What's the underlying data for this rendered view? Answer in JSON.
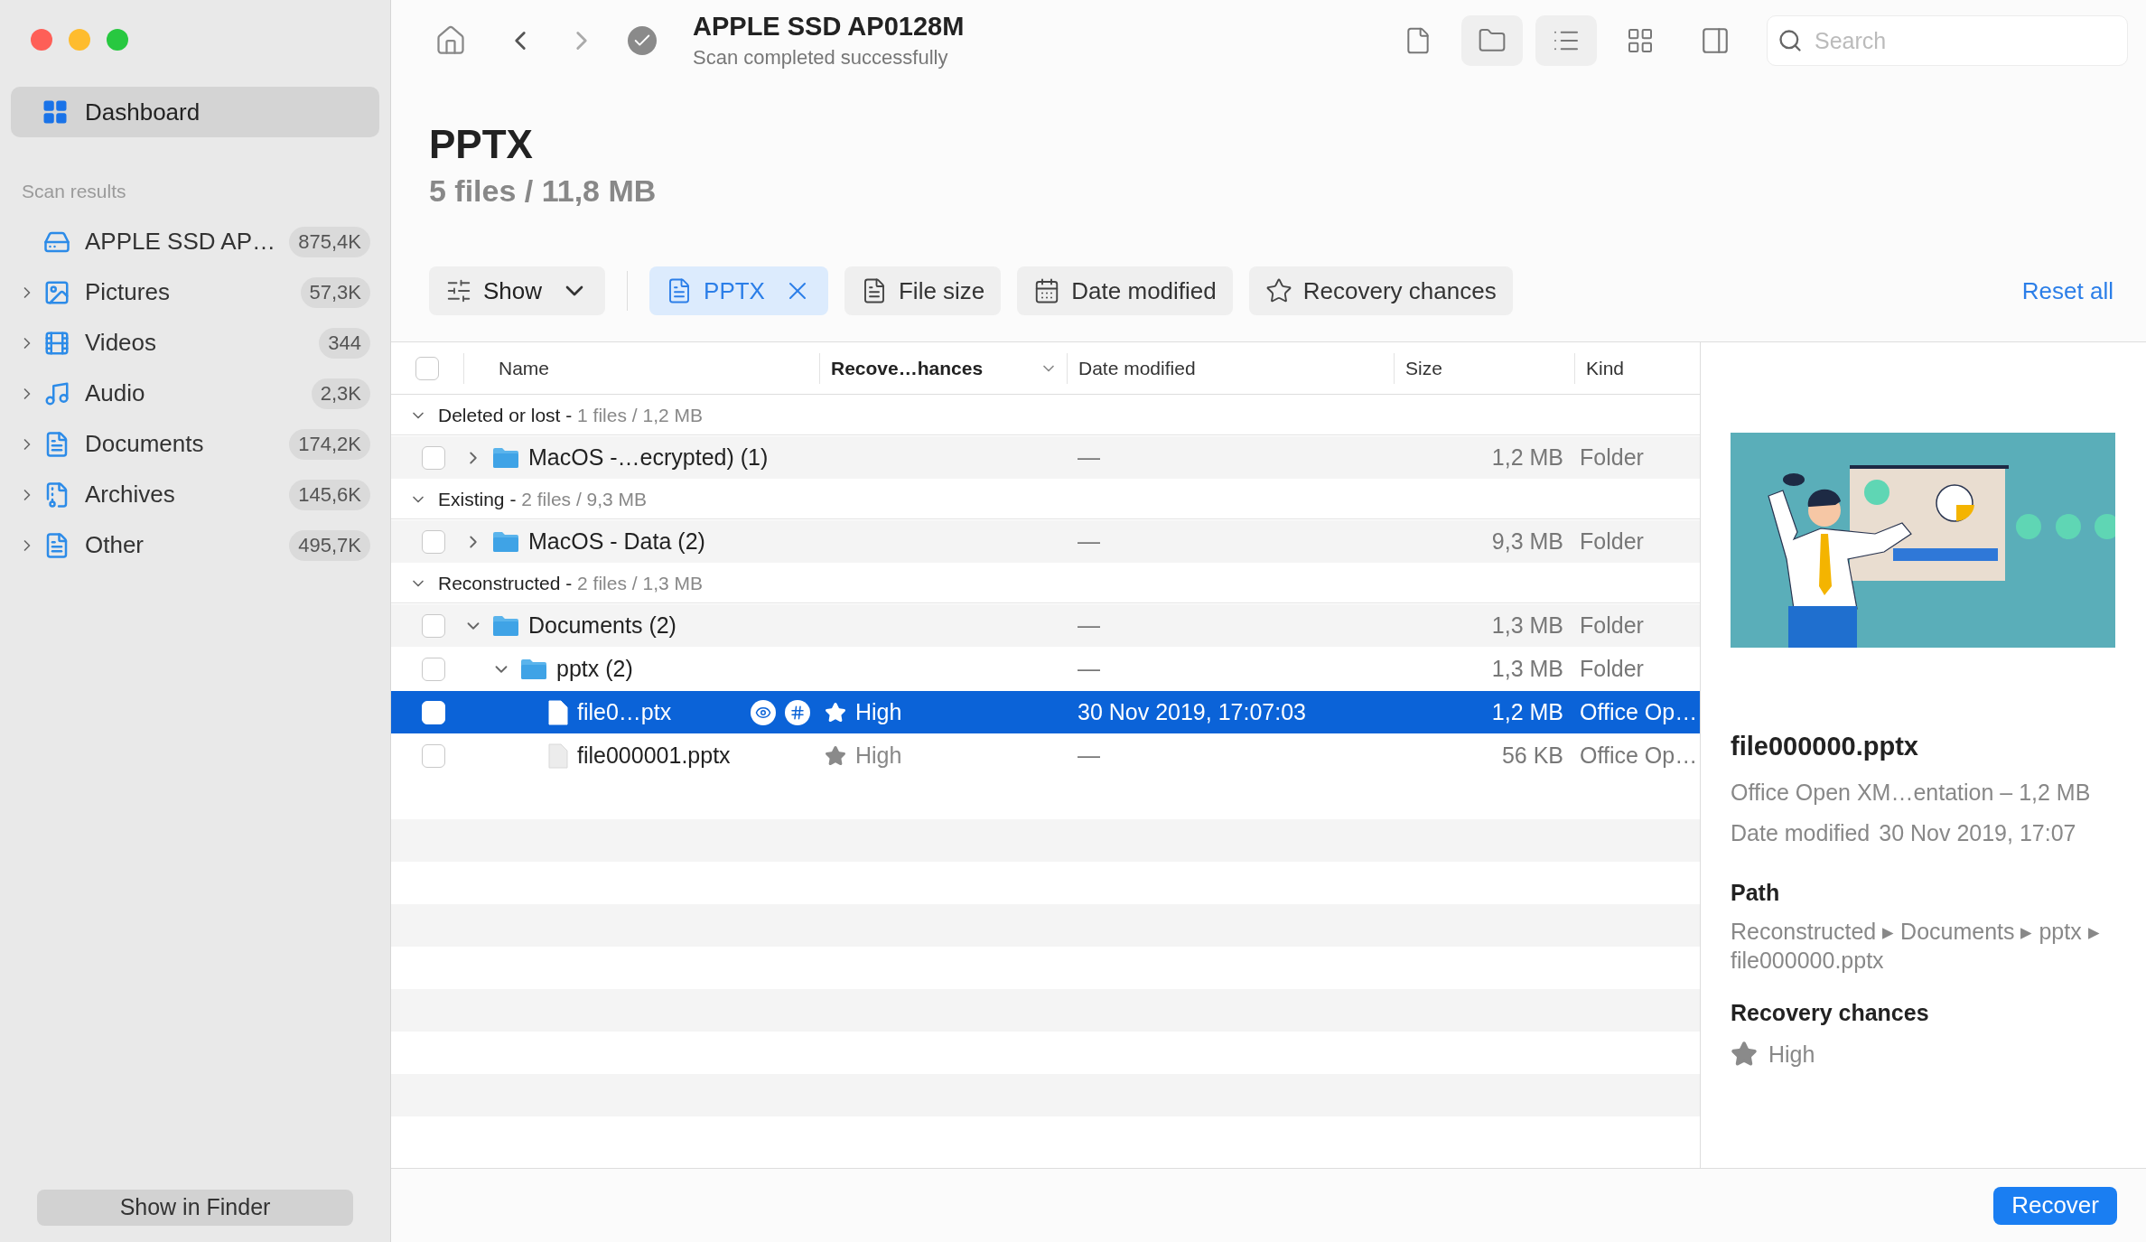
{
  "sidebar": {
    "nav": {
      "label": "Dashboard",
      "selected": true
    },
    "section": "Scan results",
    "items": [
      {
        "label": "APPLE SSD AP…",
        "count": "875,4K",
        "kind": "drive"
      },
      {
        "label": "Pictures",
        "count": "57,3K",
        "kind": "pictures",
        "expanded": false
      },
      {
        "label": "Videos",
        "count": "344",
        "kind": "videos",
        "expanded": false
      },
      {
        "label": "Audio",
        "count": "2,3K",
        "kind": "audio",
        "expanded": false
      },
      {
        "label": "Documents",
        "count": "174,2K",
        "kind": "documents",
        "expanded": false
      },
      {
        "label": "Archives",
        "count": "145,6K",
        "kind": "archives",
        "expanded": false
      },
      {
        "label": "Other",
        "count": "495,7K",
        "kind": "other",
        "expanded": false
      }
    ],
    "footer_button": "Show in Finder"
  },
  "toolbar": {
    "title": "APPLE SSD AP0128M",
    "status": "Scan completed successfully",
    "views": [
      {
        "kind": "file",
        "selected": false
      },
      {
        "kind": "folder",
        "selected": true
      },
      {
        "kind": "list",
        "selected": true
      },
      {
        "kind": "grid",
        "selected": false
      }
    ],
    "search": {
      "placeholder": "Search"
    }
  },
  "heading": {
    "title": "PPTX",
    "summary": "5 files / 11,8 MB"
  },
  "filters": {
    "show": "Show",
    "chips": [
      {
        "kind": "type",
        "label": "PPTX",
        "active": true
      },
      {
        "kind": "size",
        "label": "File size",
        "active": false
      },
      {
        "kind": "date",
        "label": "Date modified",
        "active": false
      },
      {
        "kind": "recovery",
        "label": "Recovery chances",
        "active": false
      }
    ],
    "reset": "Reset all"
  },
  "table": {
    "select_all": {
      "checked": false
    },
    "columns": [
      {
        "label": "Name",
        "sorted": false
      },
      {
        "label": "Recove…hances",
        "sorted": true
      },
      {
        "label": "Date modified",
        "sorted": false
      },
      {
        "label": "Size",
        "sorted": false
      },
      {
        "label": "Kind",
        "sorted": false
      }
    ],
    "groups": [
      {
        "title": "Deleted or lost",
        "separator": "-",
        "summary": "1 files / 1,2 MB",
        "expanded": true,
        "rows": [
          {
            "kind": "folder",
            "name": "MacOS -…ecrypted) (1)",
            "date": "—",
            "size": "1,2 MB",
            "kind_text": "Folder",
            "checked": false,
            "selected": false,
            "expanded": false
          }
        ]
      },
      {
        "title": "Existing",
        "separator": "-",
        "summary": "2 files / 9,3 MB",
        "expanded": true,
        "rows": [
          {
            "kind": "folder",
            "name": "MacOS - Data (2)",
            "date": "—",
            "size": "9,3 MB",
            "kind_text": "Folder",
            "checked": false,
            "selected": false,
            "expanded": false
          }
        ]
      },
      {
        "title": "Reconstructed",
        "separator": "-",
        "summary": "2 files / 1,3 MB",
        "expanded": true,
        "rows": [
          {
            "kind": "folder",
            "name": "Documents (2)",
            "date": "—",
            "size": "1,3 MB",
            "kind_text": "Folder",
            "checked": false,
            "selected": false,
            "expanded": true,
            "children": [
              {
                "kind": "folder",
                "name": "pptx (2)",
                "date": "—",
                "size": "1,3 MB",
                "kind_text": "Folder",
                "checked": false,
                "selected": false,
                "expanded": true,
                "children": [
                  {
                    "kind": "file",
                    "name": "file0…ptx",
                    "recovery": "High",
                    "date": "30 Nov 2019, 17:07:03",
                    "size": "1,2 MB",
                    "kind_text": "Office Op…",
                    "checked": false,
                    "selected": true
                  },
                  {
                    "kind": "file",
                    "name": "file000001.pptx",
                    "recovery": "High",
                    "date": "—",
                    "size": "56 KB",
                    "kind_text": "Office Op…",
                    "checked": false,
                    "selected": false
                  }
                ]
              }
            ]
          }
        ]
      }
    ]
  },
  "details": {
    "name": "file000000.pptx",
    "description": "Office Open XM…entation – 1,2 MB",
    "date_label": "Date modified",
    "date": "30 Nov 2019, 17:07",
    "path_label": "Path",
    "path": "Reconstructed ▸ Documents ▸ pptx ▸ file000000.pptx",
    "recovery_label": "Recovery chances",
    "recovery": "High"
  },
  "recover_button": "Recover"
}
